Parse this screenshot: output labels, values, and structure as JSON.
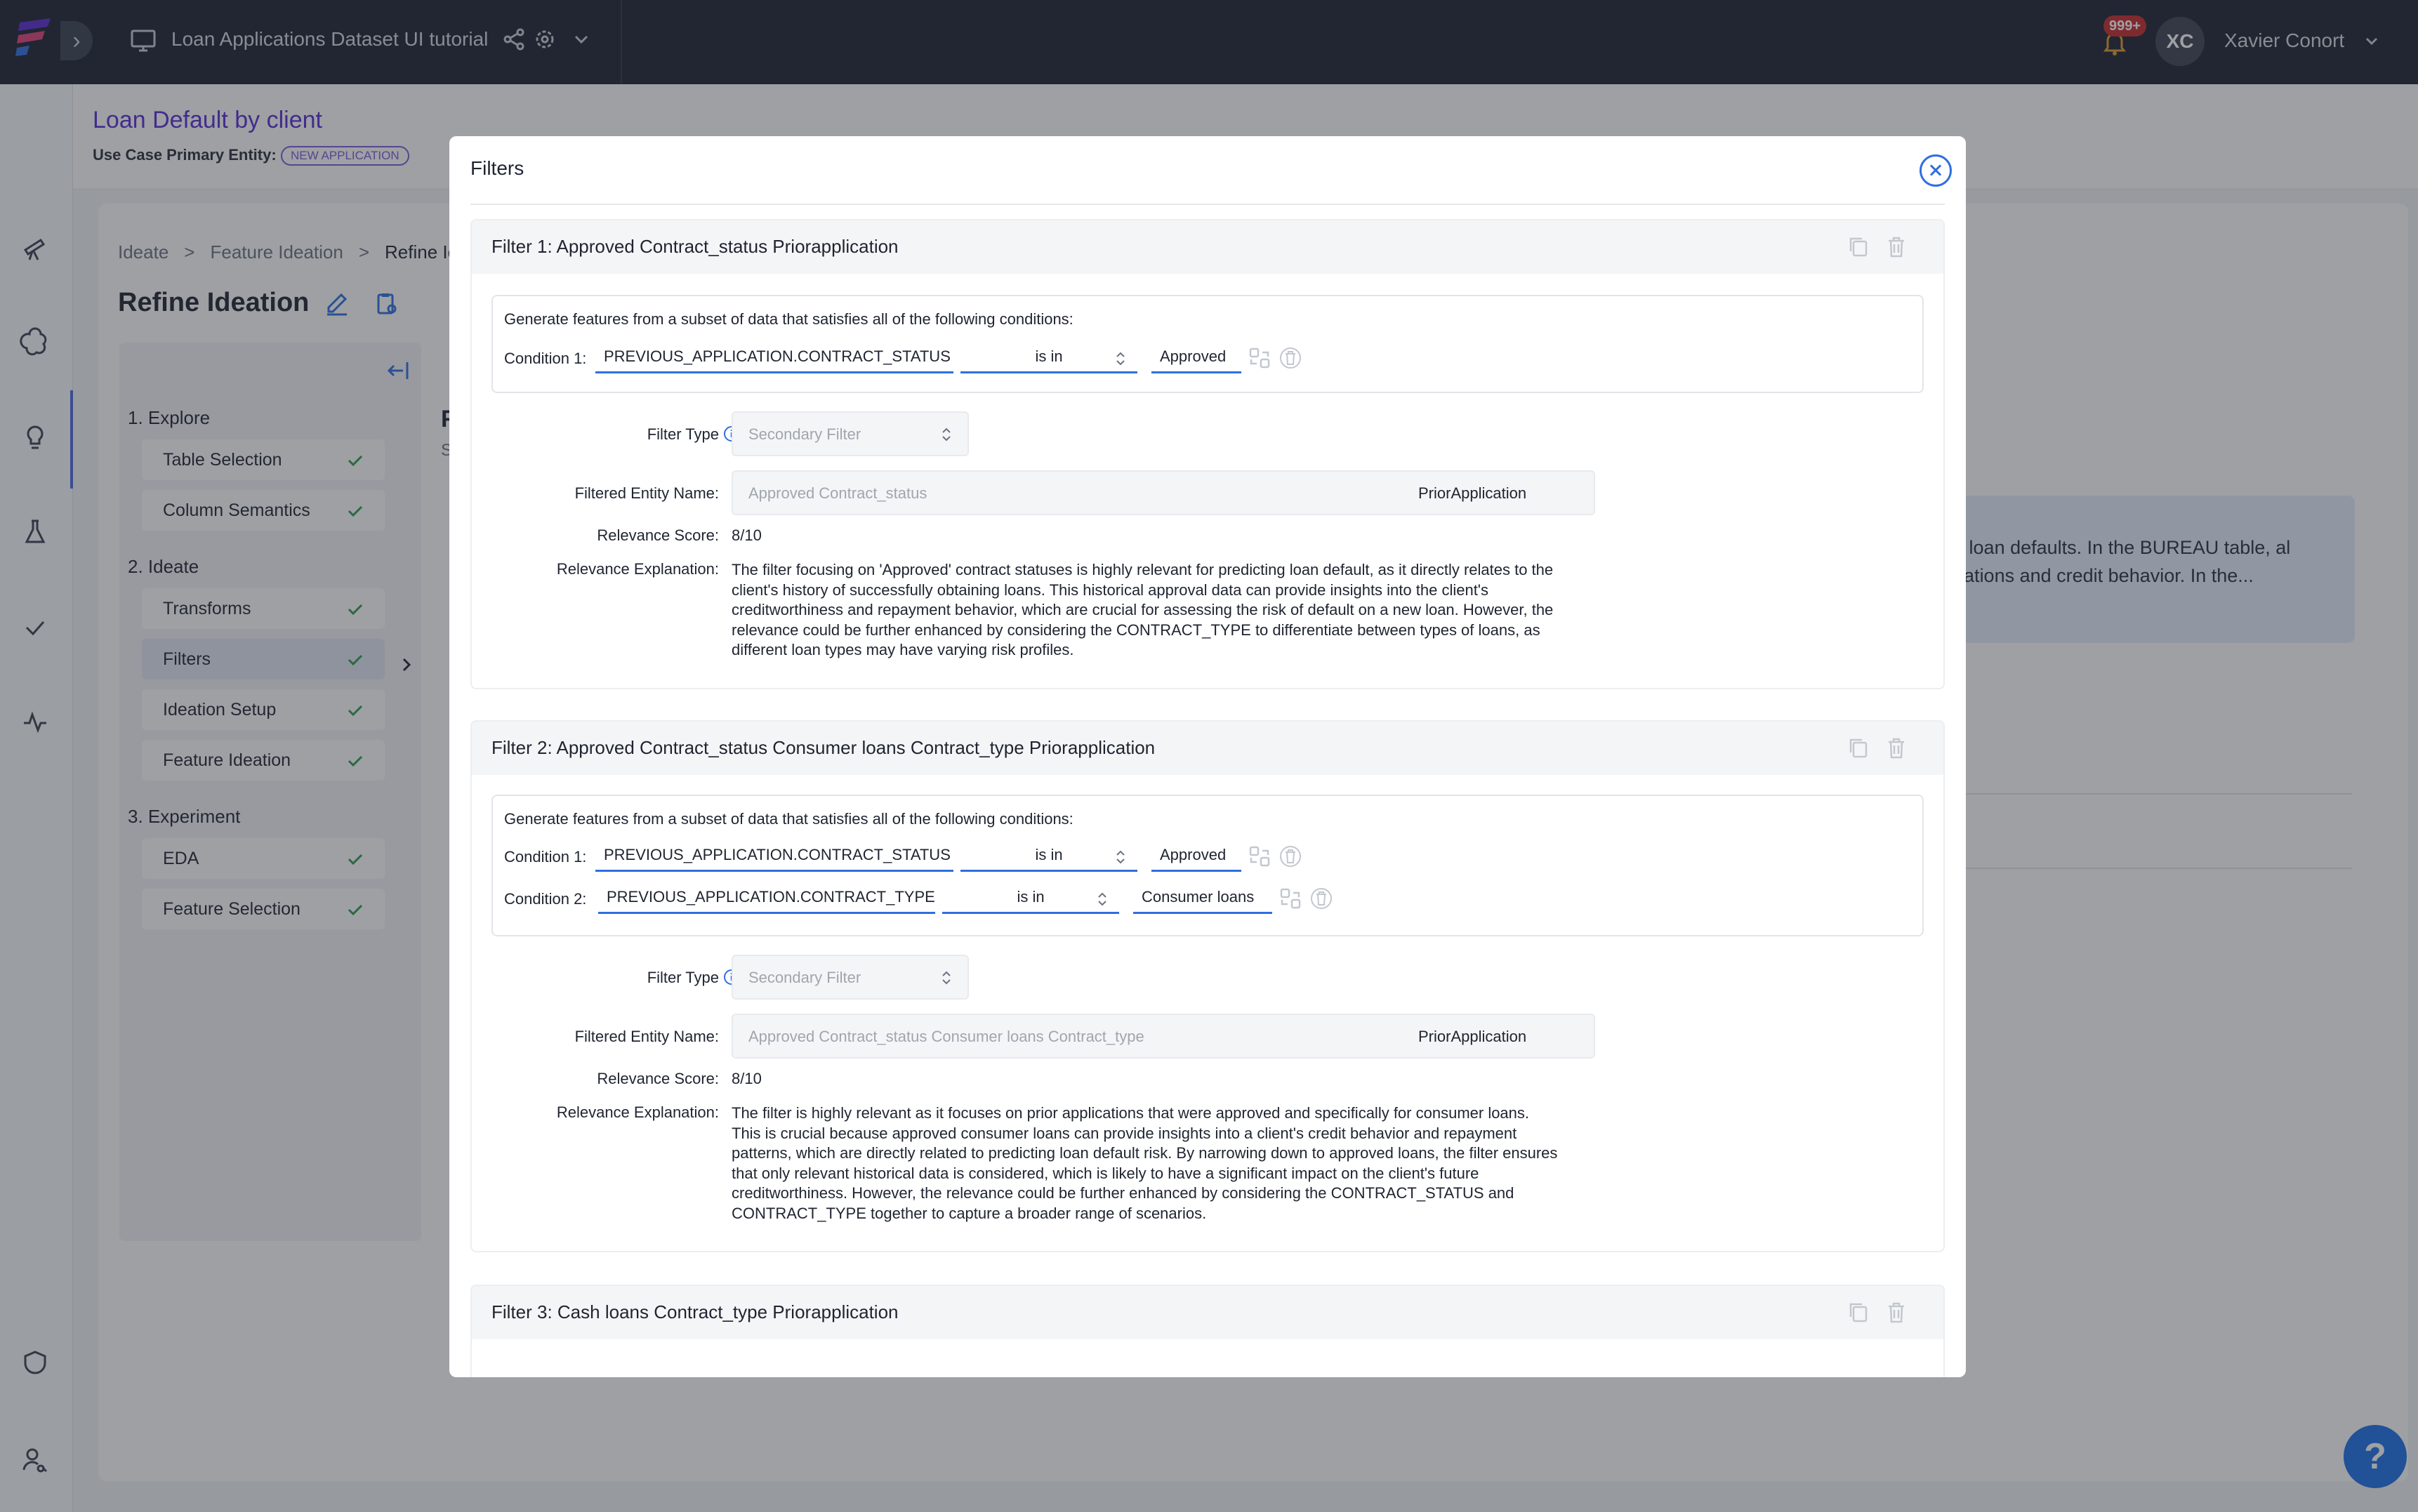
{
  "app": {
    "project_title": "Loan Applications Dataset UI tutorial",
    "notification_count": "999+",
    "user_initials": "XC",
    "user_name": "Xavier Conort",
    "accent_color": "#2f6fe0",
    "brand_color": "#5a2bd4"
  },
  "header": {
    "use_case_title": "Loan Default by client",
    "primary_entity_label": "Use Case Primary Entity:",
    "primary_entity_chip": "NEW APPLICATION"
  },
  "breadcrumb": [
    "Ideate",
    ">",
    "Feature Ideation",
    ">",
    "Refine Ic"
  ],
  "page_title": "Refine Ideation",
  "stepper": {
    "sections": [
      {
        "title": "1. Explore",
        "items": [
          "Table Selection",
          "Column Semantics"
        ]
      },
      {
        "title": "2. Ideate",
        "items": [
          "Transforms",
          "Filters",
          "Ideation Setup",
          "Feature Ideation"
        ]
      },
      {
        "title": "3. Experiment",
        "items": [
          "EDA",
          "Feature Selection"
        ]
      }
    ],
    "active_item": "Filters"
  },
  "background": {
    "info_text": "cting loan defaults. In the BUREAU table, al obligations and credit behavior. In the...",
    "letter_f": "F",
    "letter_s": "S"
  },
  "modal": {
    "title": "Filters",
    "filters": [
      {
        "title": "Filter 1: Approved Contract_status Priorapplication",
        "intro": "Generate features from a subset of data that satisfies all of the following conditions:",
        "conditions": [
          {
            "label": "Condition 1:",
            "column": "PREVIOUS_APPLICATION.CONTRACT_STATUS",
            "operator": "is in",
            "value": "Approved"
          }
        ],
        "filter_type_label": "Filter Type",
        "filter_type_value": "Secondary Filter",
        "entity_label": "Filtered Entity Name:",
        "entity_placeholder": "Approved Contract_status",
        "entity_value": "PriorApplication",
        "score_label": "Relevance Score:",
        "score": "8/10",
        "explanation_label": "Relevance Explanation:",
        "explanation_lines": [
          "The filter focusing on 'Approved' contract statuses is highly relevant for predicting loan default, as it directly relates to the",
          "client's history of successfully obtaining loans. This historical approval data can provide insights into the client's",
          "creditworthiness and repayment behavior, which are crucial for assessing the risk of default on a new loan. However, the",
          "relevance could be further enhanced by considering the CONTRACT_TYPE to differentiate between types of loans, as",
          "different loan types may have varying risk profiles."
        ]
      },
      {
        "title": "Filter 2: Approved Contract_status Consumer loans Contract_type Priorapplication",
        "intro": "Generate features from a subset of data that satisfies all of the following conditions:",
        "conditions": [
          {
            "label": "Condition 1:",
            "column": "PREVIOUS_APPLICATION.CONTRACT_STATUS",
            "operator": "is in",
            "value": "Approved"
          },
          {
            "label": "Condition 2:",
            "column": "PREVIOUS_APPLICATION.CONTRACT_TYPE",
            "operator": "is in",
            "value": "Consumer loans"
          }
        ],
        "filter_type_label": "Filter Type",
        "filter_type_value": "Secondary Filter",
        "entity_label": "Filtered Entity Name:",
        "entity_placeholder": "Approved Contract_status Consumer loans Contract_type",
        "entity_value": "PriorApplication",
        "score_label": "Relevance Score:",
        "score": "8/10",
        "explanation_label": "Relevance Explanation:",
        "explanation_lines": [
          "The filter is highly relevant as it focuses on prior applications that were approved and specifically for consumer loans.",
          "This is crucial because approved consumer loans can provide insights into a client's credit behavior and repayment",
          "patterns, which are directly related to predicting loan default risk. By narrowing down to approved loans, the filter ensures",
          "that only relevant historical data is considered, which is likely to have a significant impact on the client's future",
          "creditworthiness. However, the relevance could be further enhanced by considering the CONTRACT_STATUS and",
          "CONTRACT_TYPE together to capture a broader range of scenarios."
        ]
      },
      {
        "title": "Filter 3: Cash loans Contract_type Priorapplication"
      }
    ]
  },
  "help_label": "?"
}
